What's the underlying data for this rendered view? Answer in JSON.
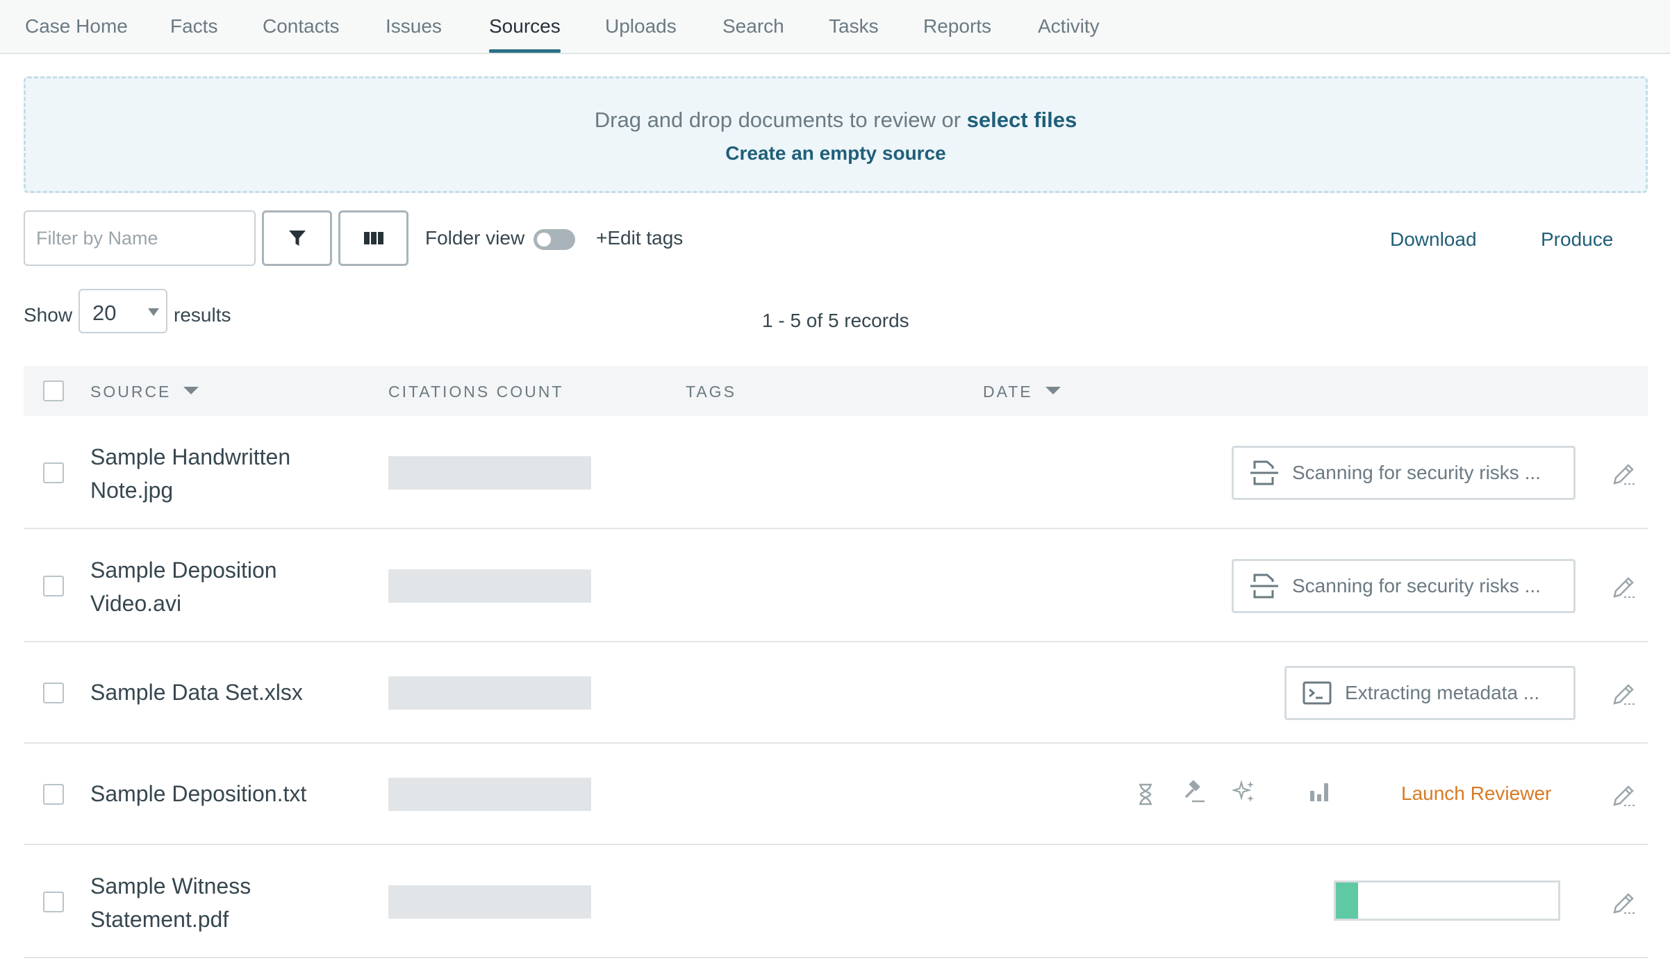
{
  "nav": {
    "tabs": [
      {
        "label": "Case Home"
      },
      {
        "label": "Facts"
      },
      {
        "label": "Contacts"
      },
      {
        "label": "Issues"
      },
      {
        "label": "Sources",
        "active": true
      },
      {
        "label": "Uploads"
      },
      {
        "label": "Search"
      },
      {
        "label": "Tasks"
      },
      {
        "label": "Reports"
      },
      {
        "label": "Activity"
      }
    ]
  },
  "dropzone": {
    "text": "Drag and drop documents to review or",
    "select_link": "select files",
    "create_link": "Create an empty source"
  },
  "toolbar": {
    "filter_placeholder": "Filter by Name",
    "filter_icon": "filter-icon",
    "columns_icon": "columns-icon",
    "folder_view_label": "Folder view",
    "folder_view_on": false,
    "edit_tags_label": "+Edit tags",
    "download_label": "Download",
    "produce_label": "Produce"
  },
  "pagination": {
    "show_label": "Show",
    "page_size": "20",
    "results_label": "results",
    "records_text": "1 - 5 of 5 records"
  },
  "table": {
    "headers": {
      "source": "SOURCE",
      "citations": "CITATIONS COUNT",
      "tags": "TAGS",
      "date": "DATE"
    },
    "rows": [
      {
        "name": "Sample Handwritten Note.jpg",
        "status": "Scanning for security risks ...",
        "status_icon": "scan-document-icon"
      },
      {
        "name": "Sample Deposition Video.avi",
        "status": "Scanning for security risks ...",
        "status_icon": "scan-document-icon"
      },
      {
        "name": "Sample Data Set.xlsx",
        "status": "Extracting metadata ...",
        "status_icon": "terminal-icon"
      },
      {
        "name": "Sample Deposition.txt",
        "action": "Launch Reviewer",
        "icons": [
          "hourglass-icon",
          "gavel-icon",
          "sparkle-icon",
          "bar-chart-icon"
        ]
      },
      {
        "name": "Sample Witness Statement.pdf",
        "progress": 0.1
      }
    ]
  },
  "colors": {
    "accent": "#205f79",
    "tab_underline": "#2b6f86",
    "launch": "#d97a23",
    "progress": "#5fc9a3",
    "dropzone_bg": "#eef6fa"
  }
}
